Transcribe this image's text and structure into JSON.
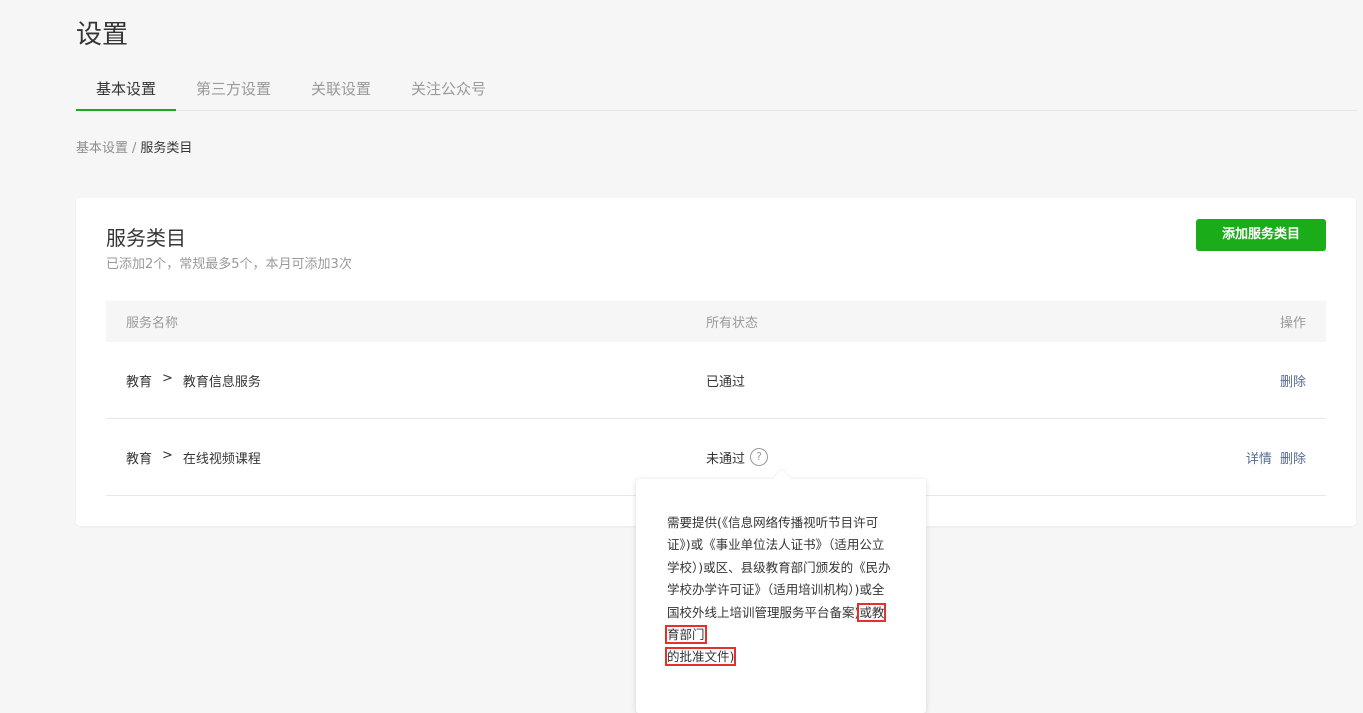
{
  "page": {
    "title": "设置"
  },
  "tabs": [
    {
      "label": "基本设置",
      "active": true
    },
    {
      "label": "第三方设置",
      "active": false
    },
    {
      "label": "关联设置",
      "active": false
    },
    {
      "label": "关注公众号",
      "active": false
    }
  ],
  "breadcrumb": {
    "parent": "基本设置",
    "separator": "/",
    "current": "服务类目"
  },
  "card": {
    "title": "服务类目",
    "description": "已添加2个，常规最多5个，本月可添加3次",
    "add_button": "添加服务类目"
  },
  "table": {
    "headers": {
      "name": "服务名称",
      "status": "所有状态",
      "operation": "操作"
    },
    "rows": [
      {
        "category": "教育",
        "arrow": ">",
        "subcategory": "教育信息服务",
        "status": "已通过",
        "actions": [
          "删除"
        ]
      },
      {
        "category": "教育",
        "arrow": ">",
        "subcategory": "在线视频课程",
        "status": "未通过",
        "help_icon": "?",
        "actions": [
          "详情",
          "删除"
        ]
      }
    ]
  },
  "tooltip": {
    "text_main": "需要提供(《信息网络传播视听节目许可证》)或《事业单位法人证书》（适用公立学校）)或区、县级教育部门颁发的《民办学校办学许可证》（适用培训机构）)或全国校外线上培训管理服务平台备案)",
    "text_highlight_1": "或教育部门",
    "text_highlight_2": "的批准文件)"
  },
  "colors": {
    "accent": "#1aad19",
    "link": "#576b95",
    "highlight_border": "#e3322b"
  }
}
